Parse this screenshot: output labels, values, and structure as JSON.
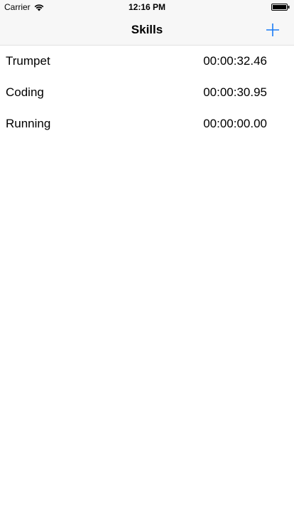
{
  "status_bar": {
    "carrier": "Carrier",
    "time": "12:16 PM"
  },
  "nav": {
    "title": "Skills",
    "add_icon": "plus-icon",
    "accent_color": "#1a7cf5"
  },
  "skills": [
    {
      "name": "Trumpet",
      "time": "00:00:32.46"
    },
    {
      "name": "Coding",
      "time": "00:00:30.95"
    },
    {
      "name": "Running",
      "time": "00:00:00.00"
    }
  ]
}
